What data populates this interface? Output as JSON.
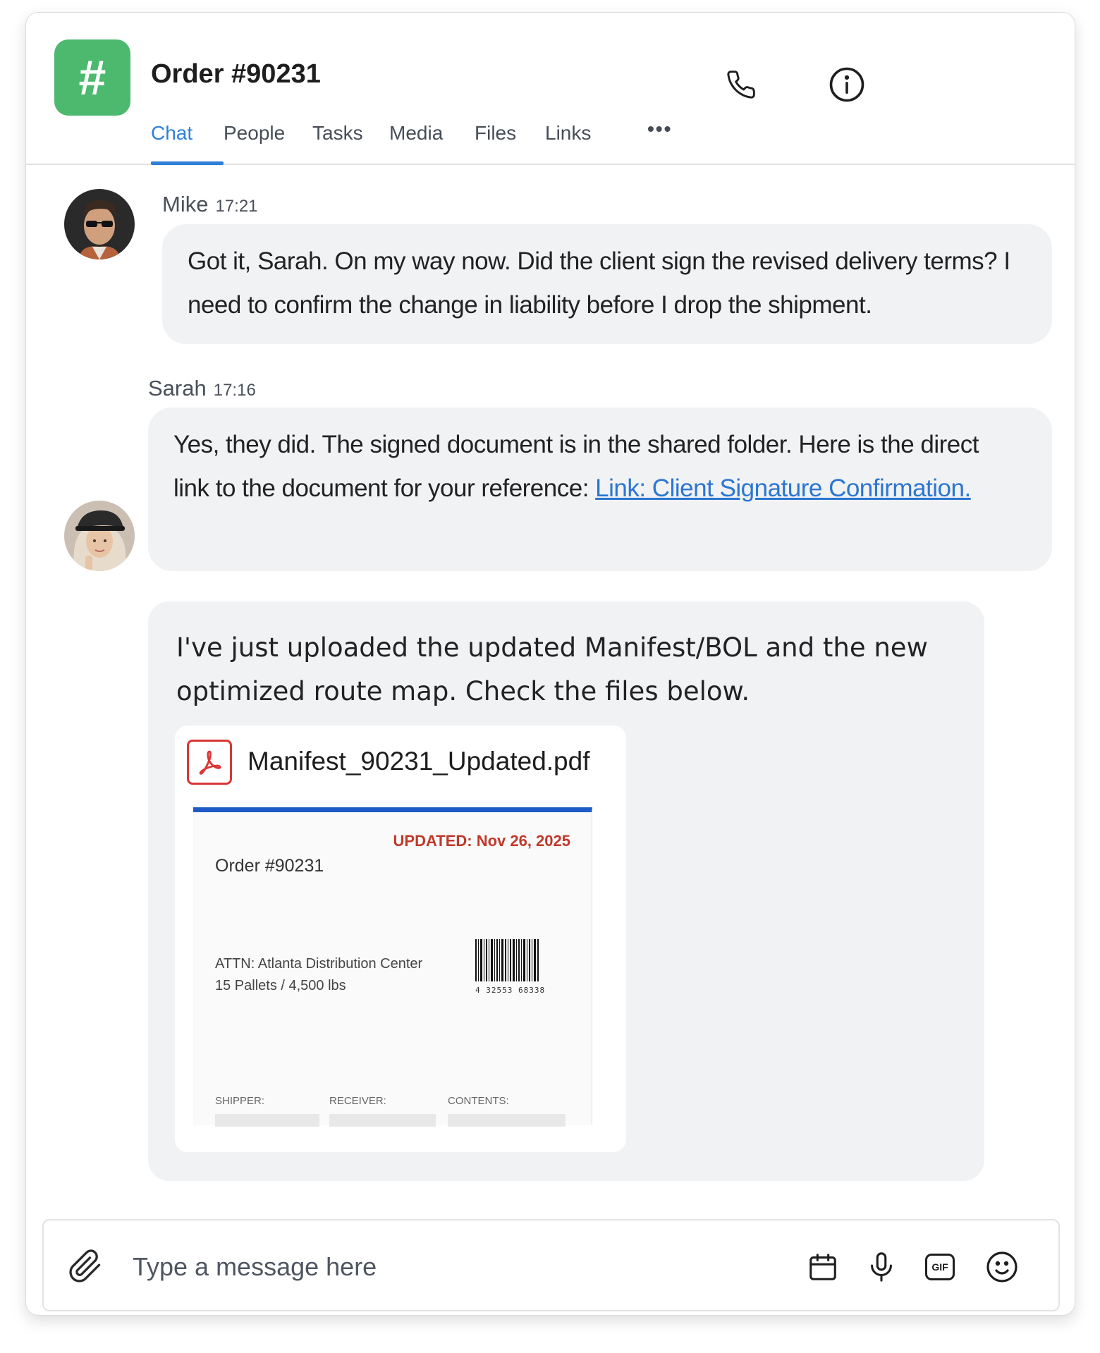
{
  "header": {
    "channel_symbol": "#",
    "title": "Order #90231",
    "tabs": [
      "Chat",
      "People",
      "Tasks",
      "Media",
      "Files",
      "Links",
      "•••"
    ],
    "active_tab": "Chat"
  },
  "messages": [
    {
      "sender": "Mike",
      "time": "17:21",
      "text": "Got it, Sarah. On my way now. Did the client sign the revised delivery terms? I need to confirm the change in liability before I drop the shipment."
    },
    {
      "sender": "Sarah",
      "time": "17:16",
      "text": "Yes, they did. The signed document is in the shared folder. Here is the direct link to the document for your reference: ",
      "link_text": "Link: Client Signature Confirmation."
    },
    {
      "text": "I've just uploaded the updated Manifest/BOL and the new optimized route map. Check the files below.",
      "attachment": {
        "file_name": "Manifest_90231_Updated.pdf",
        "preview": {
          "updated": "UPDATED: Nov 26, 2025",
          "order": "Order #90231",
          "attn": "ATTN: Atlanta Distribution Center",
          "weight": "15 Pallets / 4,500 lbs",
          "barcode_number": "4 32553 68338",
          "shipper_label": "SHIPPER:",
          "receiver_label": "RECEIVER:",
          "contents_label": "CONTENTS:"
        }
      }
    }
  ],
  "composer": {
    "placeholder": "Type a message here",
    "gif_label": "GIF"
  },
  "colors": {
    "channel_icon": "#4cb96e",
    "accent": "#2f7fd8",
    "bubble": "#f1f2f4",
    "pdf_red": "#d93636",
    "updated_red": "#c0392b"
  },
  "icons": [
    "phone-icon",
    "info-icon",
    "more-icon",
    "pdf-icon",
    "paperclip-icon",
    "calendar-icon",
    "microphone-icon",
    "gif-icon",
    "emoji-icon"
  ]
}
